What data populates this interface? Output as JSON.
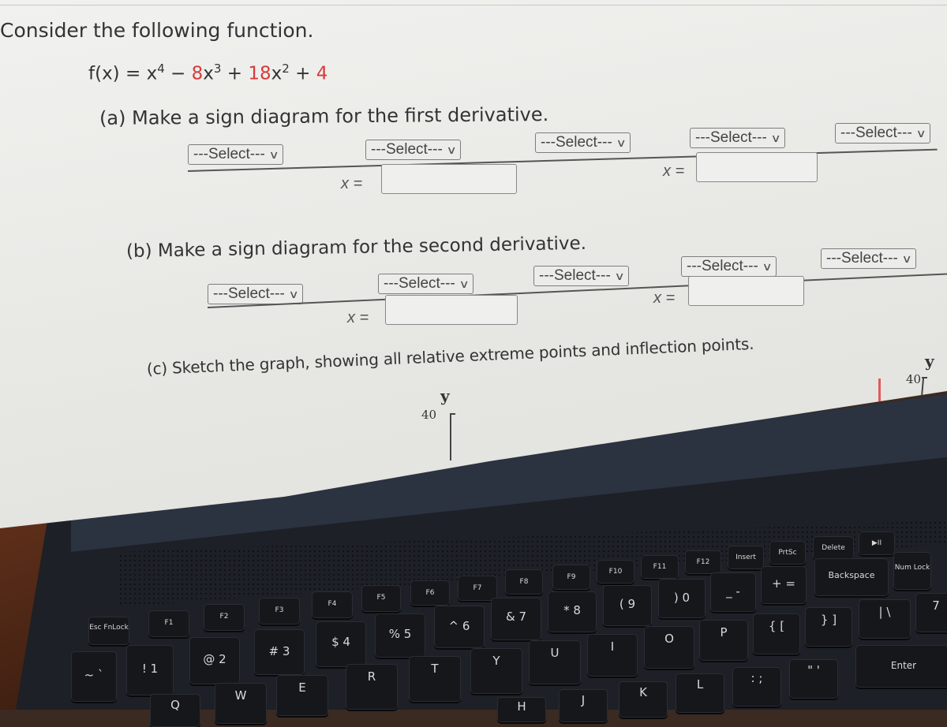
{
  "page": {
    "title": "Consider the following function.",
    "function": {
      "lhs": "f(x) = ",
      "terms": [
        {
          "text": "x",
          "exp": "4",
          "highlight": false
        },
        {
          "text": " − ",
          "exp": "",
          "highlight": false
        },
        {
          "text": "8",
          "exp": "",
          "highlight": true
        },
        {
          "text": "x",
          "exp": "3",
          "highlight": false
        },
        {
          "text": " + ",
          "exp": "",
          "highlight": false
        },
        {
          "text": "18",
          "exp": "",
          "highlight": true
        },
        {
          "text": "x",
          "exp": "2",
          "highlight": false
        },
        {
          "text": " + ",
          "exp": "",
          "highlight": false
        },
        {
          "text": "4",
          "exp": "",
          "highlight": true
        }
      ],
      "highlight_color": "#d63b3b"
    },
    "part_a": {
      "prompt": "(a) Make a sign diagram for the first derivative.",
      "selects": [
        "---Select---",
        "---Select---",
        "---Select---",
        "---Select---",
        "---Select---"
      ],
      "x_inputs": [
        {
          "label": "x =",
          "value": ""
        },
        {
          "label": "x =",
          "value": ""
        }
      ]
    },
    "part_b": {
      "prompt": "(b) Make a sign diagram for the second derivative.",
      "selects": [
        "---Select---",
        "---Select---",
        "---Select---",
        "---Select---",
        "---Select---"
      ],
      "x_inputs": [
        {
          "label": "x =",
          "value": ""
        },
        {
          "label": "x =",
          "value": ""
        }
      ]
    },
    "part_c": {
      "prompt": "(c) Sketch the graph, showing all relative extreme points and inflection points.",
      "graphs": [
        {
          "axis_label": "y",
          "top_tick": "40"
        },
        {
          "axis_label": "y",
          "top_tick": "40"
        }
      ]
    },
    "select_chevron": "chevron-down-icon"
  },
  "keyboard": {
    "function_row": [
      "Esc FnLock",
      "F1",
      "F2",
      "F3",
      "F4",
      "F5",
      "F6",
      "F7",
      "F8",
      "F9",
      "F10",
      "F11",
      "F12",
      "Insert",
      "PrtSc",
      "Delete",
      "▶II"
    ],
    "number_row": [
      "~ `",
      "! 1",
      "@ 2",
      "# 3",
      "$ 4",
      "% 5",
      "^ 6",
      "& 7",
      "* 8",
      "( 9",
      ") 0",
      "_ -",
      "+ =",
      "Backspace",
      "Num Lock"
    ],
    "top_row": [
      "Q",
      "W",
      "E",
      "R",
      "T",
      "Y",
      "U",
      "I",
      "O",
      "P",
      "{ [",
      "} ]",
      "| \\",
      "7"
    ],
    "home_row": [
      "H",
      "J",
      "K",
      "L",
      ": ;",
      "\" '",
      "Enter"
    ]
  }
}
